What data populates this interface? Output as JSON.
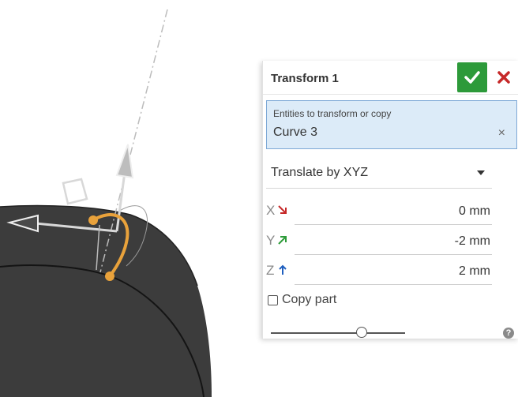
{
  "panel": {
    "title": "Transform 1",
    "entities_label": "Entities to transform or copy",
    "entities_value": "Curve 3",
    "clear_glyph": "×",
    "mode_value": "Translate by XYZ",
    "copy_part_label": "Copy part",
    "help_glyph": "?"
  },
  "axes": [
    {
      "letter": "X",
      "value": "0 mm",
      "arrow_color": "#c62828"
    },
    {
      "letter": "Y",
      "value": "-2 mm",
      "arrow_color": "#2e9b3a"
    },
    {
      "letter": "Z",
      "value": "2 mm",
      "arrow_color": "#1f5fbf"
    }
  ],
  "copy_part_checked": false,
  "colors": {
    "accept": "#2d9a3a",
    "cancel": "#c62828",
    "selection_fill": "#dcebf8",
    "part_body": "#3c3c3c",
    "curve_highlight": "#e9a23b"
  },
  "icons": [
    "checkmark-icon",
    "close-icon",
    "clear-icon",
    "chevron-down-icon",
    "help-icon",
    "translate-manipulator-icon"
  ]
}
